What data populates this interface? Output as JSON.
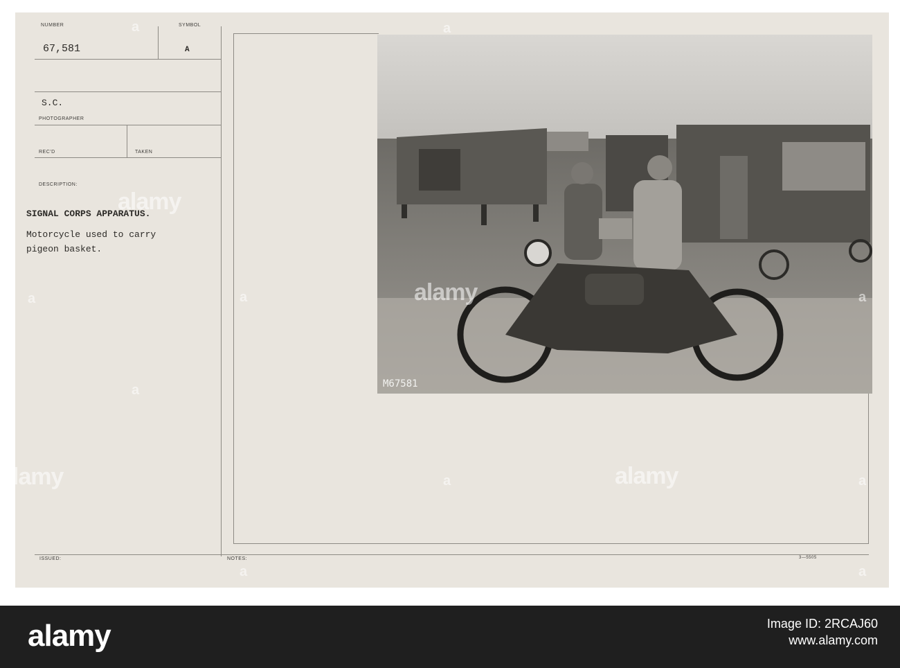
{
  "card": {
    "number_label": "NUMBER",
    "number_value": "67,581",
    "symbol_label": "SYMBOL",
    "symbol_value": "A",
    "sc_value": "S.C.",
    "photographer_label": "PHOTOGRAPHER",
    "recd_label": "REC'D",
    "taken_label": "TAKEN",
    "description_label": "DESCRIPTION:",
    "description_title": "SIGNAL CORPS APPARATUS.",
    "description_line1": "Motorcycle used to carry",
    "description_line2": "pigeon basket.",
    "issued_label": "ISSUED:",
    "notes_label": "NOTES:",
    "form_code": "3—5505"
  },
  "photo": {
    "negative_number": "M67581"
  },
  "watermark": {
    "text": "alamy",
    "letter": "a"
  },
  "footer": {
    "logo": "alamy",
    "image_id": "Image ID: 2RCAJ60",
    "site": "www.alamy.com"
  }
}
